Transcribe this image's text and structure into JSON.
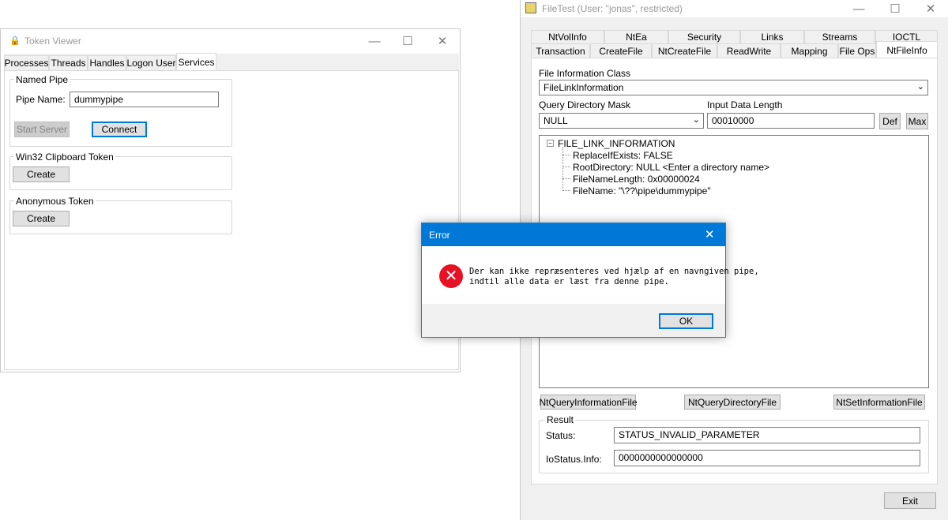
{
  "token_viewer": {
    "title": "Token Viewer",
    "tabs": [
      "Processes",
      "Threads",
      "Handles",
      "Logon User",
      "Services"
    ],
    "named_pipe": {
      "group_label": "Named Pipe",
      "pipe_name_label": "Pipe Name:",
      "pipe_name_value": "dummypipe",
      "start_server_label": "Start Server",
      "connect_label": "Connect"
    },
    "clipboard": {
      "group_label": "Win32 Clipboard Token",
      "create_label": "Create"
    },
    "anonymous": {
      "group_label": "Anonymous Token",
      "create_label": "Create"
    }
  },
  "filetest": {
    "title": "FileTest (User: \"jonas\", restricted)",
    "tabs_row1": [
      "NtVolInfo",
      "NtEa",
      "Security",
      "Links",
      "Streams",
      "IOCTL"
    ],
    "tabs_row2": [
      "Transaction",
      "CreateFile",
      "NtCreateFile",
      "ReadWrite",
      "Mapping",
      "File Ops",
      "NtFileInfo"
    ],
    "file_info_class_label": "File Information Class",
    "file_info_class_value": "FileLinkInformation",
    "query_mask_label": "Query Directory Mask",
    "query_mask_value": "NULL",
    "input_length_label": "Input Data Length",
    "input_length_value": "00010000",
    "def_label": "Def",
    "max_label": "Max",
    "tree": {
      "root": "FILE_LINK_INFORMATION",
      "children": [
        "ReplaceIfExists: FALSE",
        "RootDirectory: NULL <Enter a directory name>",
        "FileNameLength: 0x00000024",
        "FileName: \"\\??\\pipe\\dummypipe\""
      ]
    },
    "buttons": {
      "query_info": "NtQueryInformationFile",
      "query_dir": "NtQueryDirectoryFile",
      "set_info": "NtSetInformationFile",
      "exit": "Exit"
    },
    "result": {
      "group_label": "Result",
      "status_label": "Status:",
      "status_value": "STATUS_INVALID_PARAMETER",
      "iostatus_label": "IoStatus.Info:",
      "iostatus_value": "0000000000000000"
    }
  },
  "error_dialog": {
    "title": "Error",
    "message_line1": "Der kan ikke repræsenteres ved hjælp af en navngiven pipe,",
    "message_line2": "indtil alle data er læst fra denne pipe.",
    "ok_label": "OK",
    "icon": "error-icon",
    "icon_color": "#e81123"
  }
}
